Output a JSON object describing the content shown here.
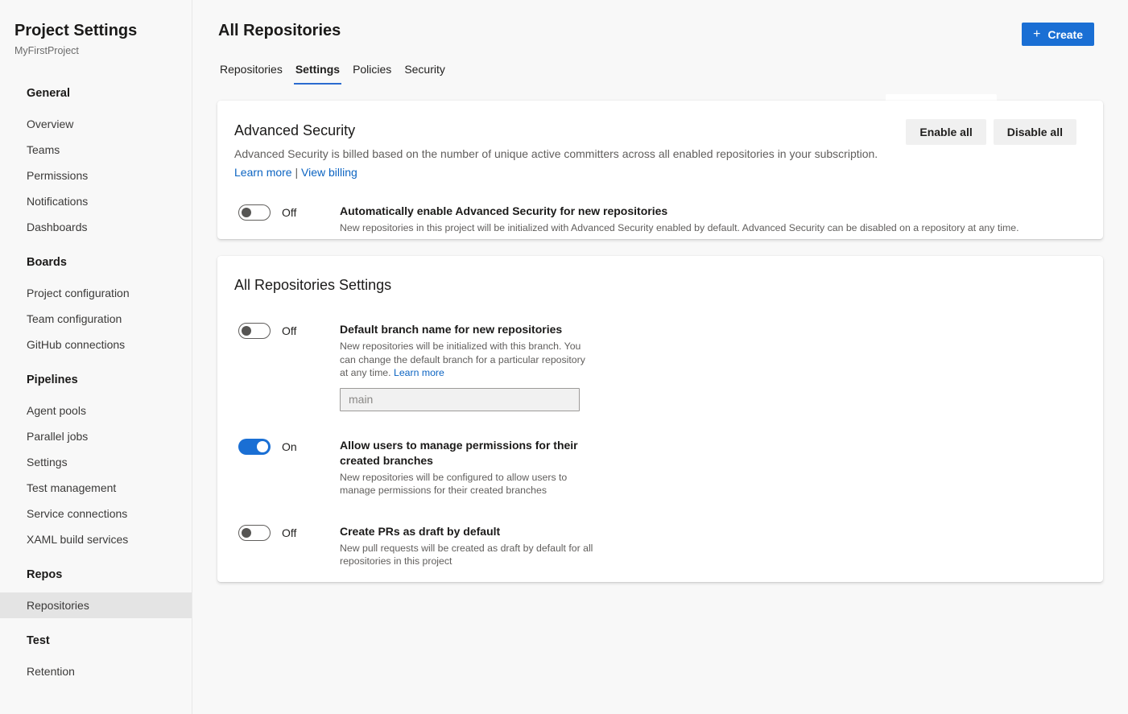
{
  "colors": {
    "accent": "#1a6fd4",
    "link": "#0c64c2",
    "page_background": "#f8f8f8",
    "card_background": "#ffffff",
    "sidebar_selected_background": "#e4e4e4",
    "neutral_button_background": "#f0f0f0",
    "text_primary": "#201f1e",
    "text_secondary": "#605e5c"
  },
  "sidebar": {
    "title": "Project Settings",
    "subtitle": "MyFirstProject",
    "selected_item": "Repositories",
    "groups": [
      {
        "label": "General",
        "items": [
          "Overview",
          "Teams",
          "Permissions",
          "Notifications",
          "Dashboards"
        ]
      },
      {
        "label": "Boards",
        "items": [
          "Project configuration",
          "Team configuration",
          "GitHub connections"
        ]
      },
      {
        "label": "Pipelines",
        "items": [
          "Agent pools",
          "Parallel jobs",
          "Settings",
          "Test management",
          "Service connections",
          "XAML build services"
        ]
      },
      {
        "label": "Repos",
        "items": [
          "Repositories"
        ]
      },
      {
        "label": "Test",
        "items": [
          "Retention"
        ]
      }
    ]
  },
  "header": {
    "title": "All Repositories",
    "create_icon": "+",
    "create_label": "Create"
  },
  "tabs": {
    "active": "Settings",
    "items": [
      {
        "label": "Repositories"
      },
      {
        "label": "Settings"
      },
      {
        "label": "Policies"
      },
      {
        "label": "Security"
      }
    ]
  },
  "advanced_security": {
    "title": "Advanced Security",
    "description": "Advanced Security is billed based on the number of unique active committers across all enabled repositories in your subscription.",
    "links": {
      "learn_more": "Learn more",
      "separator": "|",
      "view_billing": "View billing"
    },
    "buttons": {
      "enable_all": "Enable all",
      "disable_all": "Disable all"
    },
    "toggle": {
      "state": "Off",
      "title": "Automatically enable Advanced Security for new repositories",
      "description": "New repositories in this project will be initialized with Advanced Security enabled by default. Advanced Security can be disabled on a repository at any time."
    }
  },
  "repo_settings": {
    "title": "All Repositories Settings",
    "settings": [
      {
        "state": "Off",
        "title": "Default branch name for new repositories",
        "description": "New repositories will be initialized with this branch. You can change the default branch for a particular repository at any time.",
        "link": "Learn more",
        "input_placeholder": "main"
      },
      {
        "state": "On",
        "title": "Allow users to manage permissions for their created branches",
        "description": "New repositories will be configured to allow users to manage permissions for their created branches"
      },
      {
        "state": "Off",
        "title": "Create PRs as draft by default",
        "description": "New pull requests will be created as draft by default for all repositories in this project"
      }
    ]
  }
}
